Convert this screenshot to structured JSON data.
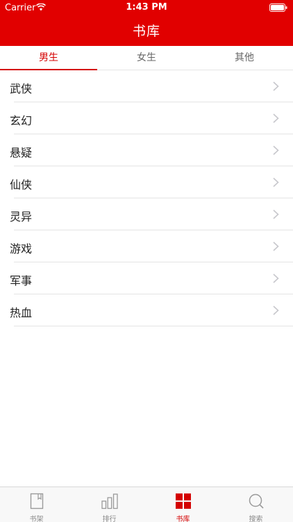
{
  "status_bar": {
    "carrier": "Carrier",
    "time": "1:43 PM"
  },
  "nav": {
    "title": "书库"
  },
  "tabs": [
    {
      "label": "男生",
      "active": true
    },
    {
      "label": "女生",
      "active": false
    },
    {
      "label": "其他",
      "active": false
    }
  ],
  "categories": [
    {
      "label": "武侠"
    },
    {
      "label": "玄幻"
    },
    {
      "label": "悬疑"
    },
    {
      "label": "仙侠"
    },
    {
      "label": "灵异"
    },
    {
      "label": "游戏"
    },
    {
      "label": "军事"
    },
    {
      "label": "热血"
    }
  ],
  "tab_bar": [
    {
      "label": "书架",
      "icon": "bookshelf-icon",
      "active": false
    },
    {
      "label": "排行",
      "icon": "ranking-icon",
      "active": false
    },
    {
      "label": "书库",
      "icon": "library-grid-icon",
      "active": true
    },
    {
      "label": "搜索",
      "icon": "search-icon",
      "active": false
    }
  ],
  "colors": {
    "accent": "#e10000",
    "active_text": "#d40000",
    "inactive_text": "#8a8a8a"
  }
}
